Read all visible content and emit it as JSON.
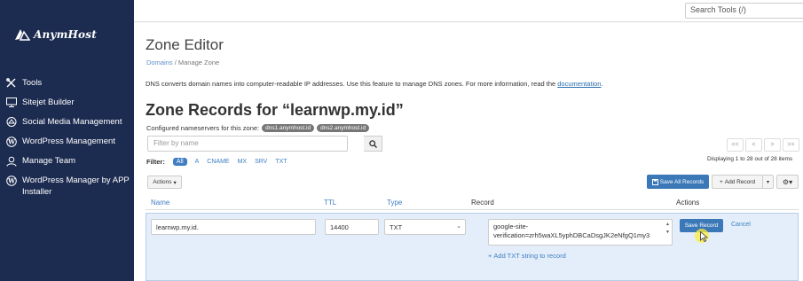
{
  "brand": {
    "name": "AnymHost"
  },
  "topbar": {
    "search_placeholder": "Search Tools (/)"
  },
  "sidebar": {
    "items": [
      {
        "label": "Tools",
        "icon": "tools-icon"
      },
      {
        "label": "Sitejet Builder",
        "icon": "monitor-icon"
      },
      {
        "label": "Social Media Management",
        "icon": "megaphone-icon"
      },
      {
        "label": "WordPress Management",
        "icon": "wordpress-icon"
      },
      {
        "label": "Manage Team",
        "icon": "user-icon"
      },
      {
        "label": "WordPress Manager by APP Installer",
        "icon": "wordpress-icon"
      }
    ]
  },
  "page": {
    "title": "Zone Editor",
    "breadcrumb": {
      "root": "Domains",
      "sep": "/",
      "current": "Manage Zone"
    },
    "intro_text": "DNS converts domain names into computer-readable IP addresses. Use this feature to manage DNS zones. For more information, read the ",
    "intro_link": "documentation",
    "intro_end": ".",
    "records_title": "Zone Records for “learnwp.my.id”",
    "ns_label": "Configured nameservers for this zone:",
    "nameservers": [
      "dns1.anymhost.id",
      "dns2.anymhost.id"
    ]
  },
  "filter": {
    "placeholder": "Filter by name",
    "label": "Filter:",
    "chips": [
      "All",
      "A",
      "CNAME",
      "MX",
      "SRV",
      "TXT"
    ],
    "active": "All"
  },
  "pagination": {
    "buttons": [
      "<<",
      "<",
      ">",
      ">>"
    ],
    "status": "Displaying 1 to 28 out of 28 items"
  },
  "toolbar": {
    "actions_label": "Actions",
    "save_all_label": "Save All Records",
    "add_record_label": "Add Record"
  },
  "table": {
    "headers": [
      "Name",
      "TTL",
      "Type",
      "Record",
      "Actions"
    ]
  },
  "edit_row": {
    "name": "learnwp.my.id.",
    "ttl": "14400",
    "type": "TXT",
    "record_line1": "google-site-",
    "record_line2": "verification=zrh5waXL5yphDBCaDsgJK2eNfgQ1my3",
    "record_line3": "...",
    "add_txt_label": "Add TXT string to record",
    "save_label": "Save Record",
    "cancel_label": "Cancel"
  },
  "colors": {
    "sidebar_bg": "#1c2b50",
    "primary": "#3b78b8",
    "link": "#3f7ec2",
    "edit_row_bg": "#e4eefa"
  }
}
